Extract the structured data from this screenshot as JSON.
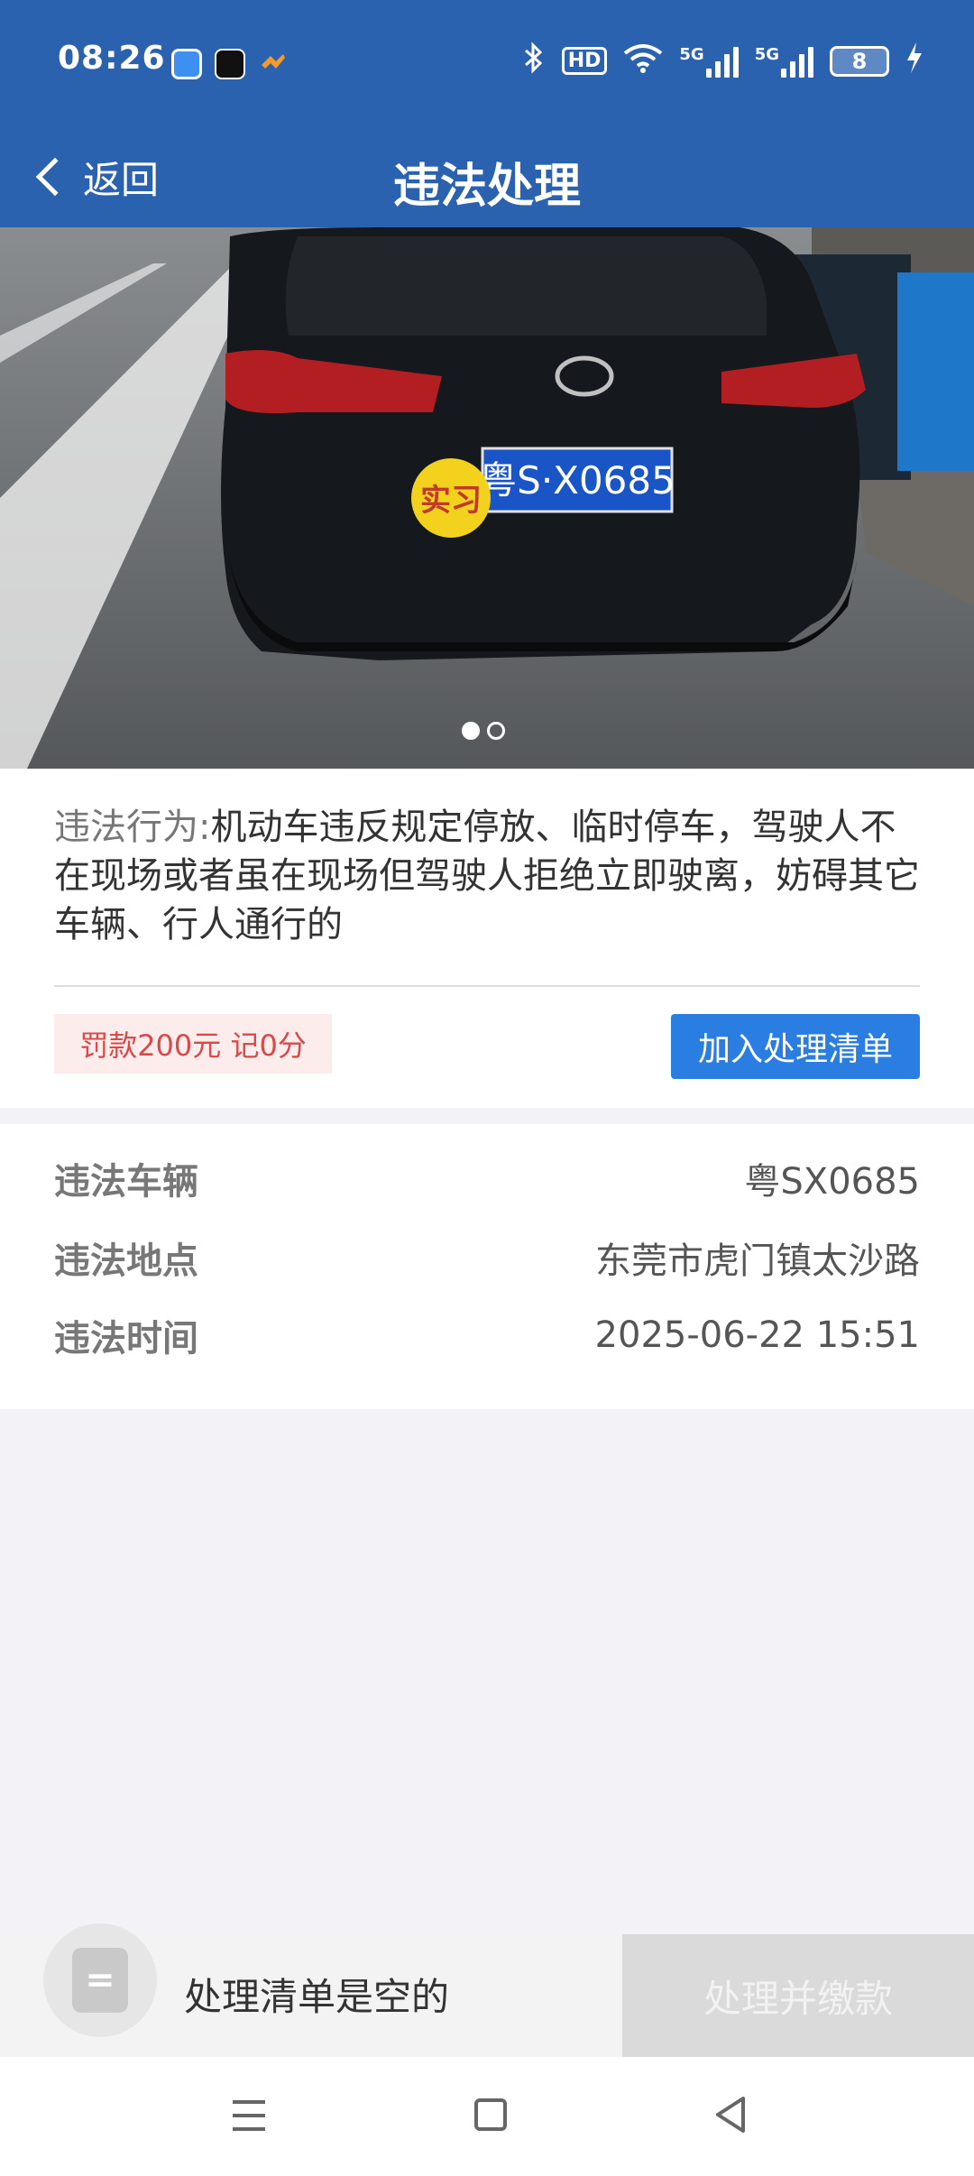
{
  "status_bar": {
    "time": "08:26",
    "network_hd": "HD",
    "signal1_label": "5G",
    "signal2_label": "5G",
    "battery": "8"
  },
  "nav": {
    "back_label": "返回",
    "title": "违法处理"
  },
  "photo": {
    "plate_text": "粤S·X0685",
    "badge_text": "实习",
    "page_count": 2,
    "active_page": 1
  },
  "violation": {
    "behavior_label": "违法行为:",
    "behavior_text": "机动车违反规定停放、临时停车，驾驶人不在现场或者虽在现场但驾驶人拒绝立即驶离，妨碍其它车辆、行人通行的",
    "fine_text": "罚款200元 记0分",
    "add_button": "加入处理清单"
  },
  "details": [
    {
      "key": "违法车辆",
      "value": "粤SX0685"
    },
    {
      "key": "违法地点",
      "value": "东莞市虎门镇太沙路"
    },
    {
      "key": "违法时间",
      "value": "2025-06-22 15:51"
    }
  ],
  "bottom": {
    "empty_text": "处理清单是空的",
    "pay_button": "处理并缴款",
    "cart_icon": "list-icon"
  },
  "colors": {
    "header": "#2a62b0",
    "primary_button": "#2a7de1",
    "fine_text": "#d84a4a",
    "fine_bg": "#fdecec"
  }
}
